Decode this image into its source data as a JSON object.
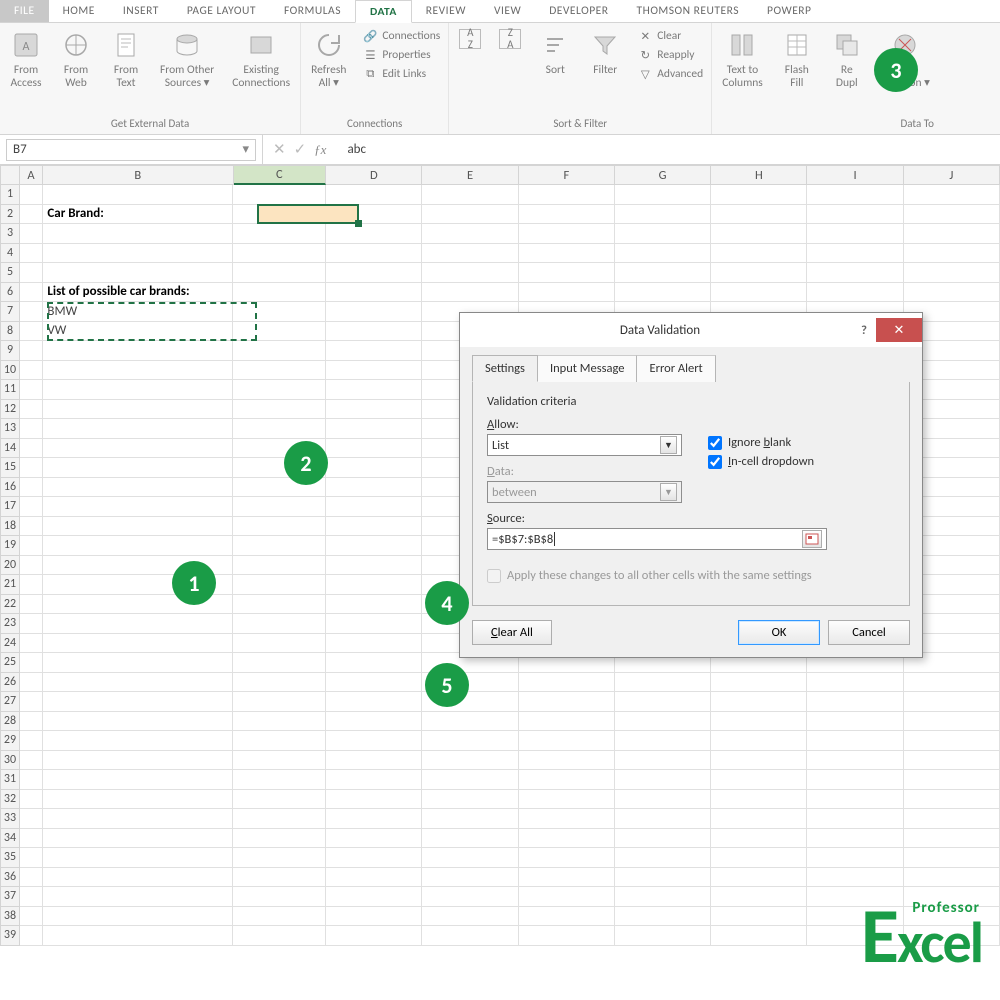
{
  "tabs": {
    "file": "FILE",
    "home": "HOME",
    "insert": "INSERT",
    "page_layout": "PAGE LAYOUT",
    "formulas": "FORMULAS",
    "data": "DATA",
    "review": "REVIEW",
    "view": "VIEW",
    "developer": "DEVELOPER",
    "thomson": "THOMSON REUTERS",
    "powerp": "POWERP"
  },
  "ribbon": {
    "ext": {
      "access": "From\nAccess",
      "web": "From\nWeb",
      "text": "From\nText",
      "other": "From Other\nSources ▾",
      "existing": "Existing\nConnections",
      "group": "Get External Data"
    },
    "conn": {
      "refresh": "Refresh\nAll ▾",
      "connections": "Connections",
      "properties": "Properties",
      "editlinks": "Edit Links",
      "group": "Connections"
    },
    "sort": {
      "sort": "Sort",
      "filter": "Filter",
      "clear": "Clear",
      "reapply": "Reapply",
      "advanced": "Advanced",
      "group": "Sort & Filter"
    },
    "tools": {
      "t2c": "Text to\nColumns",
      "flash": "Flash\nFill",
      "dup": "Re\nDupl",
      "valid": "Data\nalidation ▾",
      "group": "Data To"
    }
  },
  "namebox": "B7",
  "formula": "abc",
  "cols": [
    "A",
    "B",
    "C",
    "D",
    "E",
    "F",
    "G",
    "H",
    "I",
    "J"
  ],
  "rows_count": 39,
  "cells": {
    "B2": "Car Brand:",
    "B6": "List of possible car brands:",
    "B7": "BMW",
    "B8": "VW"
  },
  "dialog": {
    "title": "Data Validation",
    "tabs": {
      "settings": "Settings",
      "input": "Input Message",
      "error": "Error Alert"
    },
    "section": "Validation criteria",
    "allow_label": "Allow:",
    "allow_value": "List",
    "ignore": "Ignore blank",
    "incell": "In-cell dropdown",
    "data_label": "Data:",
    "data_value": "between",
    "source_label": "Source:",
    "source_value": "=$B$7:$B$8",
    "apply": "Apply these changes to all other cells with the same settings",
    "clear": "Clear All",
    "ok": "OK",
    "cancel": "Cancel"
  },
  "badges": {
    "b1": "1",
    "b2": "2",
    "b3": "3",
    "b4": "4",
    "b5": "5"
  },
  "logo": {
    "top": "Professor",
    "main": "Excel"
  }
}
